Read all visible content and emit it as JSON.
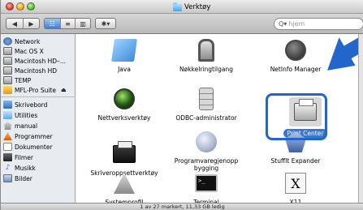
{
  "window": {
    "title": "Verktøy"
  },
  "toolbar": {
    "nav": [
      "◀",
      "▶"
    ],
    "views": [
      "☷",
      "≡",
      "▥"
    ],
    "action": "✱▾",
    "search_placeholder": "hjem",
    "search_icon": "Q▾"
  },
  "sidebar": {
    "devices": [
      {
        "label": "Network",
        "icon": "network-icon"
      },
      {
        "label": "Mac OS X",
        "icon": "hard-disk-icon"
      },
      {
        "label": "Macintosh HD–...",
        "icon": "hard-disk-icon"
      },
      {
        "label": "Macintosh HD",
        "icon": "hard-disk-icon"
      },
      {
        "label": "TEMP",
        "icon": "hard-disk-icon"
      },
      {
        "label": "MFL-Pro Suite",
        "icon": "installer-disk-icon",
        "eject": "⏏"
      }
    ],
    "places": [
      {
        "label": "Skrivebord",
        "icon": "desktop-icon"
      },
      {
        "label": "Utilities",
        "icon": "folder-icon"
      },
      {
        "label": "manual",
        "icon": "home-icon"
      },
      {
        "label": "Programmer",
        "icon": "applications-icon"
      },
      {
        "label": "Dokumenter",
        "icon": "documents-icon"
      },
      {
        "label": "Filmer",
        "icon": "movies-icon"
      },
      {
        "label": "Musikk",
        "icon": "music-icon"
      },
      {
        "label": "Bilder",
        "icon": "pictures-icon"
      }
    ]
  },
  "items": [
    {
      "label": "Java",
      "icon": "java-folder-icon"
    },
    {
      "label": "Nøkkelringtilgang",
      "icon": "keychain-icon"
    },
    {
      "label": "NetInfo Manager",
      "icon": "netinfo-icon"
    },
    {
      "label": "Nettverksverktøy",
      "icon": "network-utility-icon"
    },
    {
      "label": "ODBC-administrator",
      "icon": "odbc-icon"
    },
    {
      "label": "Print Center",
      "icon": "printer-icon",
      "selected": true
    },
    {
      "label": "Skriveroppsettverktøy",
      "icon": "printer-setup-icon"
    },
    {
      "label": "Programvaregjenoppbygging",
      "icon": "script-icon"
    },
    {
      "label": "StuffIt Expander",
      "icon": "stuffit-icon"
    },
    {
      "label": "Systemprofil",
      "icon": "system-profiler-icon"
    },
    {
      "label": "Terminal",
      "icon": "terminal-icon"
    },
    {
      "label": "X11",
      "icon": "x11-icon",
      "glyph": "X"
    }
  ],
  "status": "1 av 27 markert, 11,33 GB ledig",
  "colors": {
    "highlight": "#2266cc",
    "selection": "#3875d7"
  }
}
